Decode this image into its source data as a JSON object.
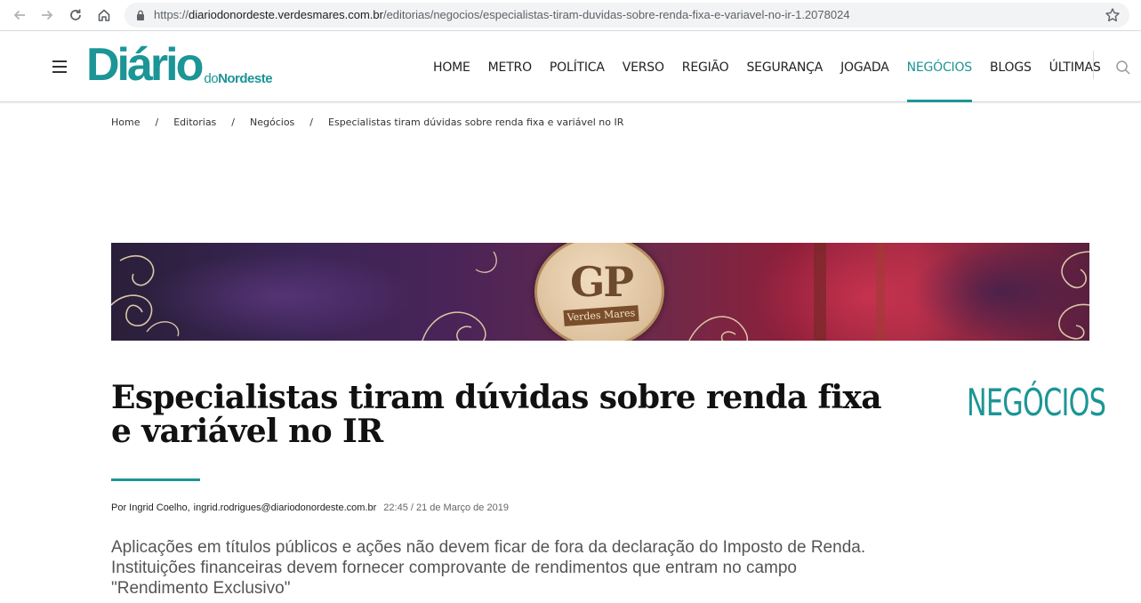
{
  "browser": {
    "url_scheme": "https://",
    "url_host": "diariodonordeste.verdesmares.com.br",
    "url_path": "/editorias/negocios/especialistas-tiram-duvidas-sobre-renda-fixa-e-variavel-no-ir-1.2078024"
  },
  "logo": {
    "main": "Diário",
    "sub_prefix": "do",
    "sub": "Nordeste"
  },
  "nav": {
    "items": [
      "HOME",
      "METRO",
      "POLÍTICA",
      "VERSO",
      "REGIÃO",
      "SEGURANÇA",
      "JOGADA",
      "NEGÓCIOS",
      "BLOGS",
      "ÚLTIMAS"
    ],
    "active": "NEGÓCIOS"
  },
  "breadcrumb": {
    "items": [
      "Home",
      "Editorias",
      "Negócios",
      "Especialistas tiram dúvidas sobre renda fixa e variável no IR"
    ],
    "separator": "/"
  },
  "banner": {
    "medal_text": "GP",
    "medal_ribbon": "Verdes Mares"
  },
  "article": {
    "headline": "Especialistas tiram dúvidas sobre renda fixa e variável no IR",
    "category": "NEGÓCIOS",
    "author": "Por Ingrid Coelho,",
    "email": "ingrid.rodrigues@diariodonordeste.com.br",
    "datetime": "22:45 / 21 de Março de 2019",
    "lead": "Aplicações em títulos públicos e ações não devem ficar de fora da declaração do Imposto de Renda. Instituições financeiras devem fornecer comprovante de rendimentos que entram no campo \"Rendimento Exclusivo\""
  },
  "colors": {
    "brand": "#1c9596"
  },
  "icons": {
    "back": "arrow-left-icon",
    "forward": "arrow-right-icon",
    "reload": "reload-icon",
    "home": "home-icon",
    "lock": "lock-icon",
    "bookmark": "star-icon",
    "menu": "hamburger-icon",
    "search": "search-icon"
  }
}
